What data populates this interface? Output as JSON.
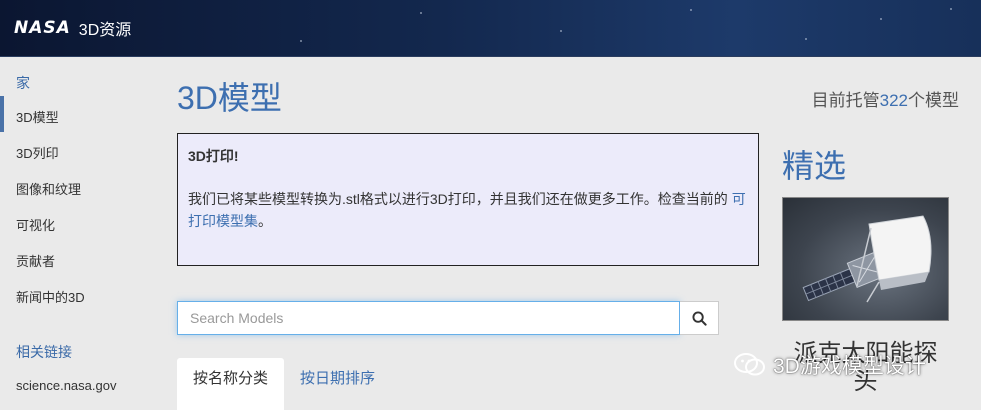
{
  "header": {
    "logo_text": "NASA",
    "site_name": "3D资源"
  },
  "sidebar": {
    "items": [
      {
        "label": "家",
        "type": "link"
      },
      {
        "label": "3D模型",
        "type": "item",
        "active": true
      },
      {
        "label": "3D列印",
        "type": "item"
      },
      {
        "label": "图像和纹理",
        "type": "item"
      },
      {
        "label": "可视化",
        "type": "item"
      },
      {
        "label": "贡献者",
        "type": "item"
      },
      {
        "label": "新闻中的3D",
        "type": "item"
      }
    ],
    "related_heading": "相关链接",
    "related_links": [
      "science.nasa.gov"
    ]
  },
  "main": {
    "title": "3D模型",
    "host_count": {
      "prefix": "目前托管",
      "count": "322",
      "suffix": "个模型"
    },
    "notice": {
      "title": "3D打印!",
      "body": "我们已将某些模型转换为.stl格式以进行3D打印，并且我们还在做更多工作。检查当前的 ",
      "link_text": "可打印模型集",
      "body_end": "。"
    },
    "search": {
      "placeholder": "Search Models",
      "value": ""
    },
    "tabs": [
      {
        "label": "按名称分类",
        "active": true
      },
      {
        "label": "按日期排序",
        "active": false
      }
    ]
  },
  "featured": {
    "heading": "精选",
    "caption": "派克太阳能探头"
  },
  "watermark": {
    "text": "3D游戏模型设计"
  },
  "colors": {
    "accent": "#3d6fb0",
    "header_bg": "#13284e",
    "notice_bg": "#ecebfa",
    "page_bg": "#eaeaea"
  }
}
